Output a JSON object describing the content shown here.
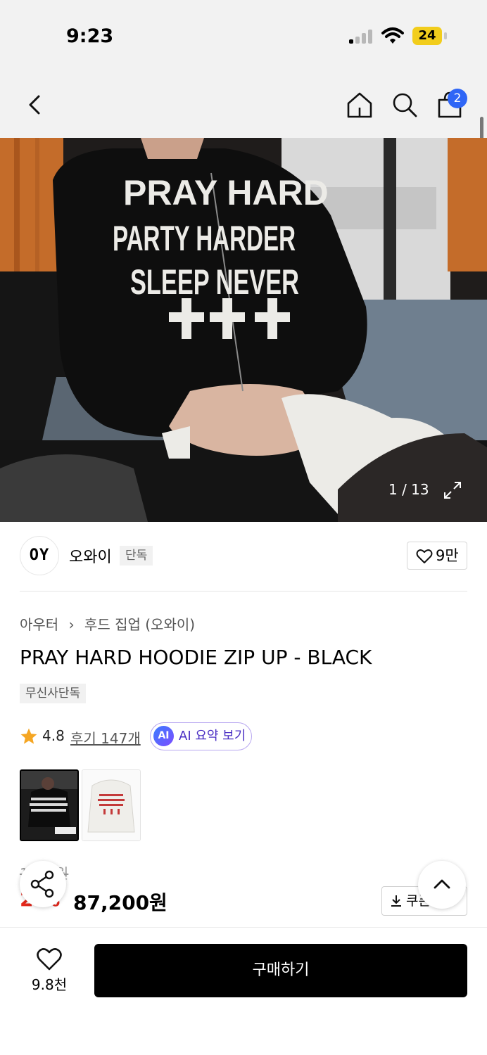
{
  "status_bar": {
    "time": "9:23",
    "battery": "24"
  },
  "nav": {
    "cart_count": "2",
    "icons": [
      "back-icon",
      "home-icon",
      "search-icon",
      "shopping-bag-icon"
    ]
  },
  "hero": {
    "counter": "1 / 13",
    "print_lines": [
      "PRAY HARD",
      "PARTY HARDER",
      "SLEEP NEVER"
    ]
  },
  "brand": {
    "logo_text": "OY",
    "name": "오와이",
    "tag": "단독",
    "likes": "9만"
  },
  "product": {
    "breadcrumb": [
      "아우터",
      "후드 집업 (오와이)"
    ],
    "title": "PRAY HARD HOODIE ZIP UP - BLACK",
    "tag": "무신사단독",
    "rating": "4.8",
    "reviews": "후기 147개",
    "ai_badge": "AI",
    "ai_summary_label": "AI 요약 보기",
    "original_price": "1 0 0원",
    "discount": "2 %",
    "price": "87,200원",
    "coupon_label": "쿠폰"
  },
  "bottom": {
    "wish_count": "9.8천",
    "buy_label": "구매하기"
  },
  "colors": {
    "accent_blue": "#2f66f6",
    "discount_red": "#e4281c",
    "ai_purple": "#4a2fc4"
  }
}
